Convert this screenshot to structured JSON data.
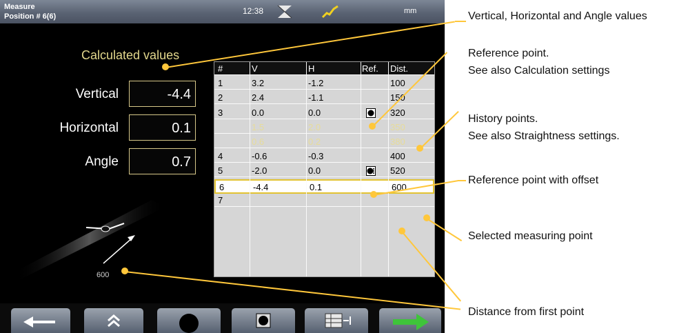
{
  "status_bar": {
    "title_line1": "Measure",
    "title_line2": "Position # 6(6)",
    "time": "12:38",
    "unit": "mm",
    "icons": [
      "hourglass-icon",
      "laser-beam-icon"
    ]
  },
  "calculated": {
    "title": "Calculated values",
    "fields": [
      {
        "label": "Vertical",
        "value": "-4.4"
      },
      {
        "label": "Horizontal",
        "value": "0.1"
      },
      {
        "label": "Angle",
        "value": "0.7"
      }
    ]
  },
  "graphic": {
    "distance_label": "600"
  },
  "table": {
    "headers": [
      "#",
      "V",
      "H",
      "Ref.",
      "Dist."
    ],
    "rows": [
      {
        "n": "1",
        "v": "3.2",
        "h": "-1.2",
        "ref": "",
        "dist": "100",
        "kind": "normal"
      },
      {
        "n": "2",
        "v": "2.4",
        "h": "-1.1",
        "ref": "",
        "dist": "150",
        "kind": "normal"
      },
      {
        "n": "3",
        "v": "0.0",
        "h": "0.0",
        "ref": "reference-point-icon",
        "dist": "320",
        "kind": "normal"
      },
      {
        "n": "",
        "v": "1.5",
        "h": "2.0",
        "ref": "",
        "dist": "350",
        "kind": "history"
      },
      {
        "n": "",
        "v": "0.6",
        "h": "0.2",
        "ref": "",
        "dist": "380",
        "kind": "history"
      },
      {
        "n": "4",
        "v": "-0.6",
        "h": "-0.3",
        "ref": "",
        "dist": "400",
        "kind": "normal"
      },
      {
        "n": "5",
        "v": "-2.0",
        "h": "0.0",
        "ref": "reference-offset-icon",
        "dist": "520",
        "kind": "normal"
      },
      {
        "n": "6",
        "v": "-4.4",
        "h": "0.1",
        "ref": "",
        "dist": "600",
        "kind": "selected"
      },
      {
        "n": "7",
        "v": "",
        "h": "",
        "ref": "",
        "dist": "",
        "kind": "normal"
      }
    ]
  },
  "toolbar": [
    "back-arrow-icon",
    "chevrons-up-icon",
    "point-icon",
    "reference-point-icon",
    "table-settings-icon",
    "forward-arrow-icon"
  ],
  "annotations": {
    "values": "Vertical, Horizontal and Angle values",
    "ref_line1": "Reference point.",
    "ref_line2": "See also Calculation settings",
    "hist_line1": "History points.",
    "hist_line2": "See also Straightness settings.",
    "ref_offset": "Reference point with offset",
    "selected": "Selected measuring point",
    "distance": "Distance from first point"
  },
  "colors": {
    "accent": "#ffc73b",
    "history_text": "#e7dc99",
    "title_text": "#e2d78c",
    "forward_arrow": "#3fc43a"
  }
}
